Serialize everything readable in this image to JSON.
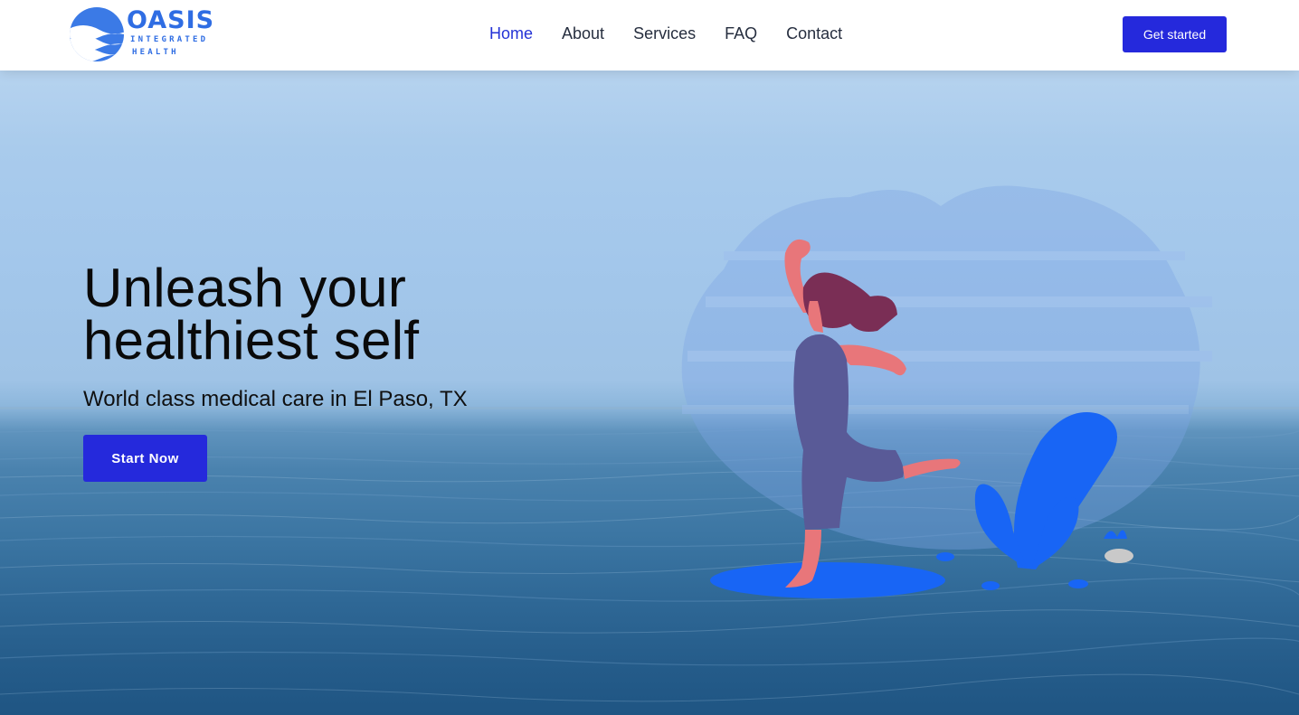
{
  "brand": {
    "name": "OASIS",
    "line1": "INTEGRATED",
    "line2": "HEALTH",
    "logo_icon": "wave-globe-icon",
    "color": "#2f6de3"
  },
  "nav": {
    "items": [
      {
        "label": "Home",
        "active": true
      },
      {
        "label": "About",
        "active": false
      },
      {
        "label": "Services",
        "active": false
      },
      {
        "label": "FAQ",
        "active": false
      },
      {
        "label": "Contact",
        "active": false
      }
    ]
  },
  "header": {
    "cta_label": "Get started"
  },
  "hero": {
    "headline_line1": "Unleash your",
    "headline_line2": "healthiest self",
    "subheadline": "World class medical care in El Paso, TX",
    "cta_label": "Start Now",
    "illustration": "woman-dancing-water-splash-illustration"
  },
  "colors": {
    "accent": "#2529dc",
    "nav_active": "#2433d6",
    "nav_text": "#262e3f",
    "splash": "#1865f5"
  }
}
